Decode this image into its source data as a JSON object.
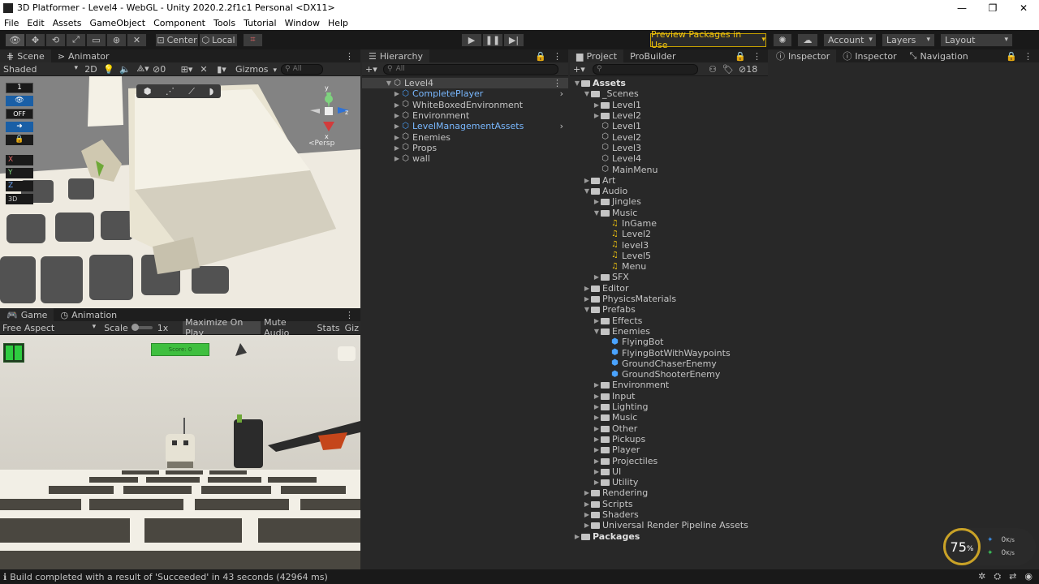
{
  "window": {
    "title": "3D Platformer - Level4 - WebGL - Unity 2020.2.2f1c1 Personal <DX11>",
    "minimize": "—",
    "maximize": "❐",
    "close": "✕"
  },
  "menu": [
    "File",
    "Edit",
    "Assets",
    "GameObject",
    "Component",
    "Tools",
    "Tutorial",
    "Window",
    "Help"
  ],
  "toolbar": {
    "center": "Center",
    "local": "Local",
    "preview": "Preview Packages in Use",
    "account": "Account",
    "layers": "Layers",
    "layout": "Layout"
  },
  "scene": {
    "tab_scene": "Scene",
    "tab_animator": "Animator",
    "shading": "Shaded",
    "mode2d": "2D",
    "count": "0",
    "gizmos": "Gizmos",
    "search": "All",
    "persp": "<Persp",
    "gizmo_y": "y",
    "gizmo_z": "z",
    "gizmo_x": "x",
    "side": [
      "1",
      "OFF",
      "3D"
    ],
    "axes": [
      "X",
      "Y",
      "Z"
    ]
  },
  "game": {
    "tab_game": "Game",
    "tab_animation": "Animation",
    "aspect": "Free Aspect",
    "scale_label": "Scale",
    "scale_value": "1x",
    "maximize": "Maximize On Play",
    "mute": "Mute Audio",
    "stats": "Stats",
    "gizmos": "Giz",
    "score": "Score: 0"
  },
  "hierarchy": {
    "tab": "Hierarchy",
    "search": "All",
    "root": "Level4",
    "items": [
      {
        "label": "CompletePlayer",
        "prefab": true,
        "arrow": true
      },
      {
        "label": "WhiteBoxedEnvironment",
        "prefab": false,
        "arrow": false
      },
      {
        "label": "Environment",
        "prefab": false,
        "arrow": false
      },
      {
        "label": "LevelManagementAssets",
        "prefab": true,
        "arrow": true
      },
      {
        "label": "Enemies",
        "prefab": false,
        "arrow": false
      },
      {
        "label": "Props",
        "prefab": false,
        "arrow": false
      },
      {
        "label": "wall",
        "prefab": false,
        "arrow": false
      }
    ]
  },
  "project": {
    "tab_project": "Project",
    "tab_probuilder": "ProBuilder",
    "hidden_count": "18",
    "tree": [
      {
        "label": "Assets",
        "depth": 0,
        "type": "folder",
        "tri": "open",
        "bold": true
      },
      {
        "label": "_Scenes",
        "depth": 1,
        "type": "folder",
        "tri": "open"
      },
      {
        "label": "Level1",
        "depth": 2,
        "type": "folder",
        "tri": "closed"
      },
      {
        "label": "Level2",
        "depth": 2,
        "type": "folder",
        "tri": "closed"
      },
      {
        "label": "Level1",
        "depth": 2,
        "type": "scene",
        "tri": ""
      },
      {
        "label": "Level2",
        "depth": 2,
        "type": "scene",
        "tri": ""
      },
      {
        "label": "Level3",
        "depth": 2,
        "type": "scene",
        "tri": ""
      },
      {
        "label": "Level4",
        "depth": 2,
        "type": "scene",
        "tri": ""
      },
      {
        "label": "MainMenu",
        "depth": 2,
        "type": "scene",
        "tri": ""
      },
      {
        "label": "Art",
        "depth": 1,
        "type": "folder",
        "tri": "closed"
      },
      {
        "label": "Audio",
        "depth": 1,
        "type": "folder",
        "tri": "open"
      },
      {
        "label": "Jingles",
        "depth": 2,
        "type": "folder",
        "tri": "closed"
      },
      {
        "label": "Music",
        "depth": 2,
        "type": "folder",
        "tri": "open"
      },
      {
        "label": "InGame",
        "depth": 3,
        "type": "music",
        "tri": ""
      },
      {
        "label": "Level2",
        "depth": 3,
        "type": "music",
        "tri": ""
      },
      {
        "label": "level3",
        "depth": 3,
        "type": "music",
        "tri": ""
      },
      {
        "label": "Level5",
        "depth": 3,
        "type": "music",
        "tri": ""
      },
      {
        "label": "Menu",
        "depth": 3,
        "type": "music",
        "tri": ""
      },
      {
        "label": "SFX",
        "depth": 2,
        "type": "folder",
        "tri": "closed"
      },
      {
        "label": "Editor",
        "depth": 1,
        "type": "folder",
        "tri": "closed"
      },
      {
        "label": "PhysicsMaterials",
        "depth": 1,
        "type": "folder",
        "tri": "closed"
      },
      {
        "label": "Prefabs",
        "depth": 1,
        "type": "folder",
        "tri": "open"
      },
      {
        "label": "Effects",
        "depth": 2,
        "type": "folder",
        "tri": "closed"
      },
      {
        "label": "Enemies",
        "depth": 2,
        "type": "folder",
        "tri": "open"
      },
      {
        "label": "FlyingBot",
        "depth": 3,
        "type": "prefab",
        "tri": ""
      },
      {
        "label": "FlyingBotWithWaypoints",
        "depth": 3,
        "type": "prefab",
        "tri": ""
      },
      {
        "label": "GroundChaserEnemy",
        "depth": 3,
        "type": "prefab",
        "tri": ""
      },
      {
        "label": "GroundShooterEnemy",
        "depth": 3,
        "type": "prefab",
        "tri": ""
      },
      {
        "label": "Environment",
        "depth": 2,
        "type": "folder",
        "tri": "closed"
      },
      {
        "label": "Input",
        "depth": 2,
        "type": "folder",
        "tri": "closed"
      },
      {
        "label": "Lighting",
        "depth": 2,
        "type": "folder",
        "tri": "closed"
      },
      {
        "label": "Music",
        "depth": 2,
        "type": "folder",
        "tri": "closed"
      },
      {
        "label": "Other",
        "depth": 2,
        "type": "folder",
        "tri": "closed"
      },
      {
        "label": "Pickups",
        "depth": 2,
        "type": "folder",
        "tri": "closed"
      },
      {
        "label": "Player",
        "depth": 2,
        "type": "folder",
        "tri": "closed"
      },
      {
        "label": "Projectiles",
        "depth": 2,
        "type": "folder",
        "tri": "closed"
      },
      {
        "label": "UI",
        "depth": 2,
        "type": "folder",
        "tri": "closed"
      },
      {
        "label": "Utility",
        "depth": 2,
        "type": "folder",
        "tri": "closed"
      },
      {
        "label": "Rendering",
        "depth": 1,
        "type": "folder",
        "tri": "closed"
      },
      {
        "label": "Scripts",
        "depth": 1,
        "type": "folder",
        "tri": "closed"
      },
      {
        "label": "Shaders",
        "depth": 1,
        "type": "folder",
        "tri": "closed"
      },
      {
        "label": "Universal Render Pipeline Assets",
        "depth": 1,
        "type": "folder",
        "tri": "closed"
      },
      {
        "label": "Packages",
        "depth": 0,
        "type": "folder",
        "tri": "closed",
        "bold": true
      }
    ]
  },
  "inspector": {
    "tab1": "Inspector",
    "tab2": "Inspector",
    "tab3": "Navigation"
  },
  "overlay": {
    "percent": "75",
    "percent_sign": "%",
    "up": "0",
    "down": "0",
    "unit": "K/s"
  },
  "status": {
    "message": "Build completed with a result of 'Succeeded' in 43 seconds (42964 ms)"
  }
}
